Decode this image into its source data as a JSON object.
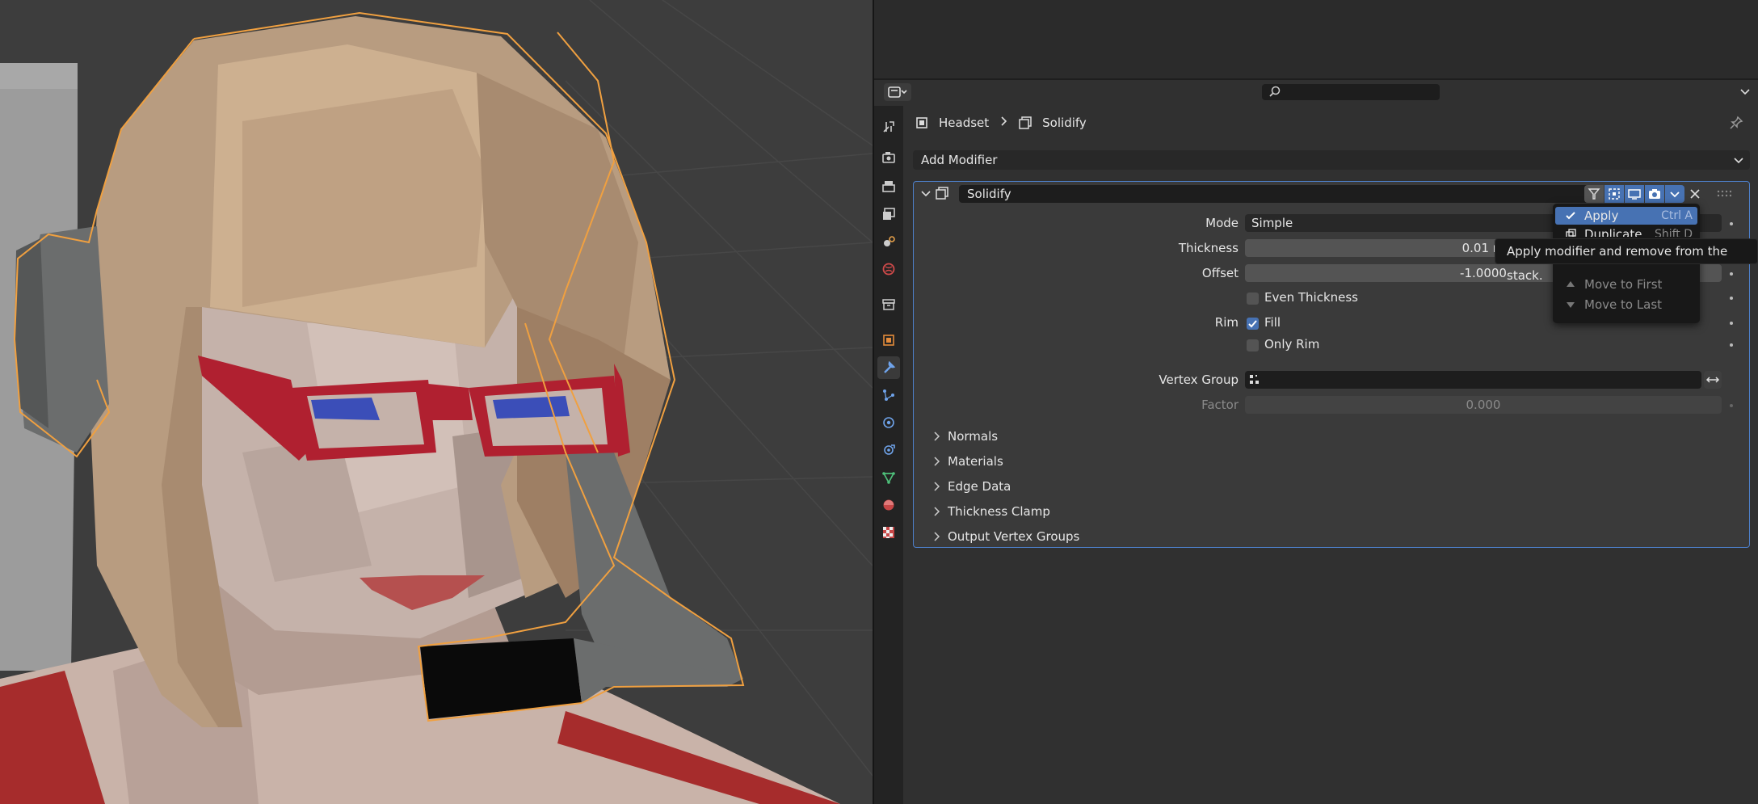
{
  "breadcrumb": {
    "object": "Headset",
    "modifier": "Solidify"
  },
  "add_modifier": "Add Modifier",
  "modifier": {
    "name": "Solidify",
    "mode": {
      "label": "Mode",
      "value": "Simple"
    },
    "thickness": {
      "label": "Thickness",
      "value": "0.01 m"
    },
    "offset": {
      "label": "Offset",
      "value": "-1.0000"
    },
    "even_thickness": {
      "label": "Even Thickness",
      "checked": false
    },
    "rim": {
      "label": "Rim",
      "fill_label": "Fill",
      "fill_checked": true,
      "only_rim_label": "Only Rim",
      "only_rim_checked": false
    },
    "vertex_group": {
      "label": "Vertex Group",
      "value": ""
    },
    "factor": {
      "label": "Factor",
      "value": "0.000"
    },
    "subpanels": [
      "Normals",
      "Materials",
      "Edge Data",
      "Thickness Clamp",
      "Output Vertex Groups"
    ]
  },
  "menu": {
    "items": [
      {
        "label": "Apply",
        "shortcut": "Ctrl A",
        "highlighted": true
      },
      {
        "label": "Duplicate",
        "shortcut": "Shift D",
        "highlighted": false
      },
      {
        "label": "Move to First",
        "shortcut": "",
        "disabled": true
      },
      {
        "label": "Move to Last",
        "shortcut": "",
        "disabled": true
      }
    ]
  },
  "tooltip": "Apply modifier and remove from the stack.",
  "colors": {
    "accent": "#4772b3",
    "selection_outline": "#f0a040",
    "panel_border": "#4d7fc9"
  },
  "tabs": [
    "tool",
    "render",
    "output",
    "view-layer",
    "scene",
    "world",
    "collection",
    "object",
    "modifiers",
    "particles",
    "physics",
    "constraints",
    "data",
    "material",
    "texture"
  ]
}
